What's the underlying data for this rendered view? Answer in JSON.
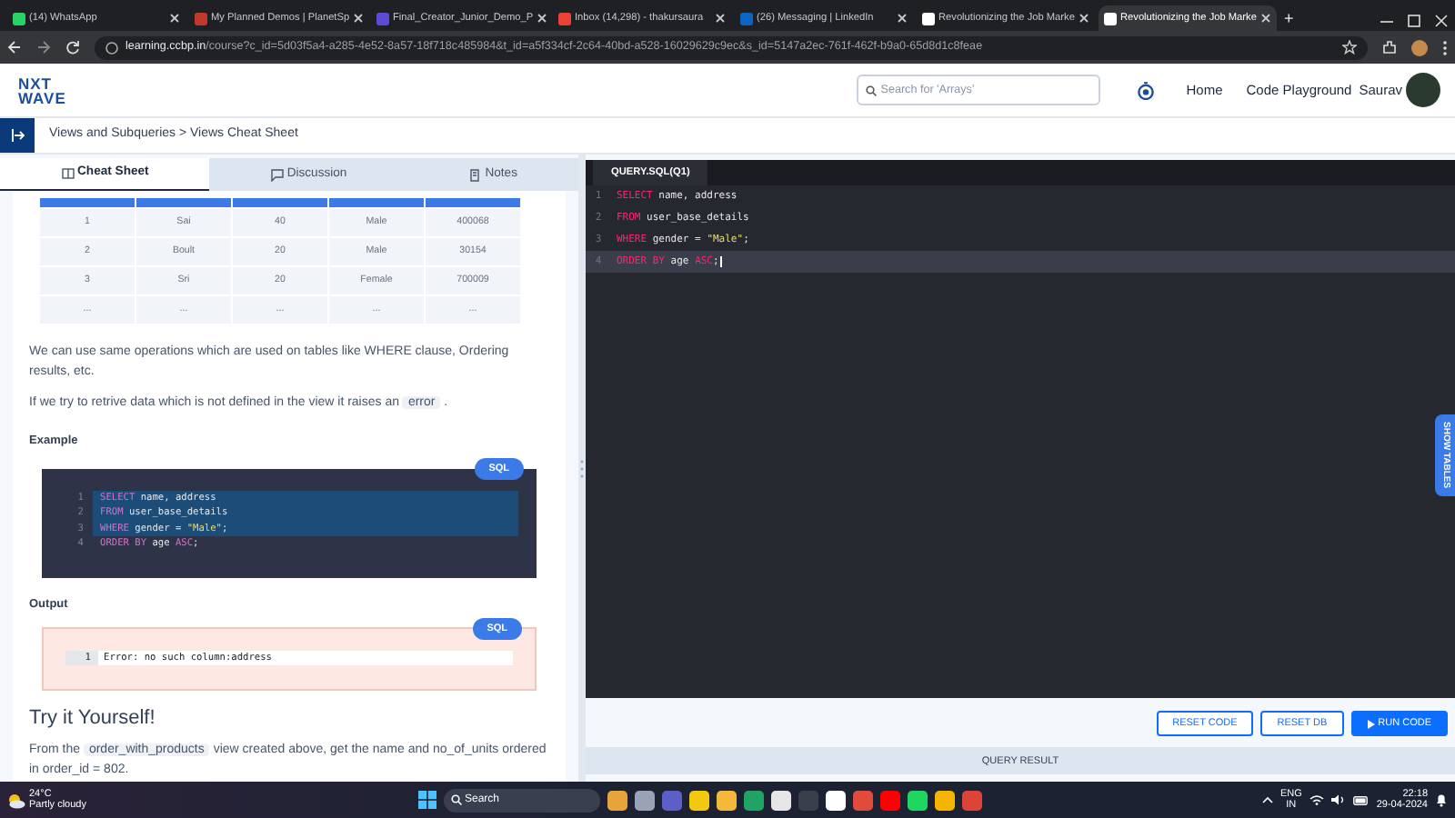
{
  "browser": {
    "tabs": [
      {
        "title": "(14) WhatsApp",
        "color": "#25d366",
        "selected": false
      },
      {
        "title": "My Planned Demos | PlanetSp",
        "color": "#c0392b",
        "selected": false
      },
      {
        "title": "Final_Creator_Junior_Demo_P",
        "color": "#5b4bd6",
        "selected": false
      },
      {
        "title": "Inbox (14,298) - thakursaura",
        "color": "#ea4335",
        "selected": false
      },
      {
        "title": "(26) Messaging | LinkedIn",
        "color": "#0a66c2",
        "selected": false
      },
      {
        "title": "Revolutionizing the Job Marke",
        "color": "#ffffff",
        "selected": false
      },
      {
        "title": "Revolutionizing the Job Marke",
        "color": "#ffffff",
        "selected": true
      }
    ],
    "new_tab": "+",
    "url_host": "learning.ccbp.in",
    "url_path": "/course?c_id=5d03f5a4-a285-4e52-8a57-18f718c485984&t_id=a5f334cf-2c64-40bd-a528-16029629c9ec&s_id=5147a2ec-761f-462f-b9a0-65d8d1c8feae"
  },
  "header": {
    "logo_top": "NXT",
    "logo_bottom": "WAVE",
    "search": {
      "placeholder": "Search for 'Arrays'"
    },
    "links": [
      "Home",
      "Code Playground"
    ],
    "user": "Saurav"
  },
  "breadcrumb": "Views and Subqueries > Views Cheat Sheet",
  "left_tabs": [
    {
      "label": "Cheat Sheet",
      "selected": true
    },
    {
      "label": "Discussion",
      "selected": false
    },
    {
      "label": "Notes",
      "selected": false
    }
  ],
  "table": {
    "rows": [
      [
        "1",
        "Sai",
        "40",
        "Male",
        "400068"
      ],
      [
        "2",
        "Boult",
        "20",
        "Male",
        "30154"
      ],
      [
        "3",
        "Sri",
        "20",
        "Female",
        "700009"
      ],
      [
        "...",
        "...",
        "...",
        "...",
        "..."
      ]
    ]
  },
  "paragraphs": [
    [
      {
        "kind": "text",
        "text": "We can use same operations which are used on tables like WHERE clause, Ordering results, etc."
      }
    ],
    [
      {
        "kind": "text",
        "text": "If we try to retrive data which is not defined in the view it raises an "
      },
      {
        "kind": "code",
        "text": "error"
      },
      {
        "kind": "text",
        "text": " ."
      }
    ]
  ],
  "example": {
    "heading": "Example",
    "badge": "SQL",
    "lines": [
      {
        "number": "1",
        "highlighted": true,
        "tokens": [
          {
            "kind": "keyword",
            "text": "SELECT"
          },
          {
            "kind": "plain",
            "text": " name, address"
          }
        ]
      },
      {
        "number": "2",
        "highlighted": true,
        "tokens": [
          {
            "kind": "keyword",
            "text": "FROM"
          },
          {
            "kind": "plain",
            "text": " user_base_details"
          }
        ]
      },
      {
        "number": "3",
        "highlighted": true,
        "tokens": [
          {
            "kind": "keyword",
            "text": "WHERE"
          },
          {
            "kind": "plain",
            "text": " gender = "
          },
          {
            "kind": "string",
            "text": "\"Male\""
          },
          {
            "kind": "plain",
            "text": ";"
          }
        ]
      },
      {
        "number": "4",
        "highlighted": false,
        "tokens": [
          {
            "kind": "keyword",
            "text": "ORDER BY"
          },
          {
            "kind": "plain",
            "text": " age "
          },
          {
            "kind": "keyword",
            "text": "ASC"
          },
          {
            "kind": "plain",
            "text": ";"
          }
        ]
      }
    ]
  },
  "output": {
    "heading": "Output",
    "badge": "SQL",
    "line_number": "1",
    "text": "Error: no such column:address"
  },
  "try_heading": "Try it Yourself!",
  "try_paragraph": [
    {
      "kind": "text",
      "text": "From the "
    },
    {
      "kind": "code",
      "text": "order_with_products"
    },
    {
      "kind": "text",
      "text": " view created above, get the name and no_of_units ordered in order_id = 802."
    }
  ],
  "editor": {
    "tab": "QUERY.SQL(Q1)",
    "lines": [
      {
        "number": "1",
        "active": false,
        "tokens": [
          {
            "kind": "keyword",
            "text": "SELECT"
          },
          {
            "kind": "plain",
            "text": " name, address"
          }
        ]
      },
      {
        "number": "2",
        "active": false,
        "tokens": [
          {
            "kind": "keyword",
            "text": "FROM"
          },
          {
            "kind": "plain",
            "text": " user_base_details"
          }
        ]
      },
      {
        "number": "3",
        "active": false,
        "tokens": [
          {
            "kind": "keyword",
            "text": "WHERE"
          },
          {
            "kind": "plain",
            "text": " gender = "
          },
          {
            "kind": "string",
            "text": "\"Male\""
          },
          {
            "kind": "plain",
            "text": ";"
          }
        ]
      },
      {
        "number": "4",
        "active": true,
        "tokens": [
          {
            "kind": "keyword",
            "text": "ORDER BY"
          },
          {
            "kind": "plain",
            "text": " age "
          },
          {
            "kind": "keyword",
            "text": "ASC"
          },
          {
            "kind": "plain",
            "text": ";"
          }
        ]
      }
    ],
    "side_tab": "SHOW TABLES",
    "buttons": [
      {
        "label": "RESET CODE",
        "kind": "outline"
      },
      {
        "label": "RESET DB",
        "kind": "outline"
      },
      {
        "label": "RUN CODE",
        "kind": "primary"
      }
    ],
    "result_bar": "QUERY RESULT"
  },
  "taskbar": {
    "temperature": "24°C",
    "weather": "Partly cloudy",
    "search": "Search",
    "apps": [
      {
        "color": "#e8a33c"
      },
      {
        "color": "#9aa3b5"
      },
      {
        "color": "#5b5fc7"
      },
      {
        "color": "#f2c811"
      },
      {
        "color": "#f5b83d"
      },
      {
        "color": "#1fa463"
      },
      {
        "color": "#e6e6e6"
      },
      {
        "color": "#3a3f4b"
      },
      {
        "color": "#ffffff"
      },
      {
        "color": "#e04b3c"
      },
      {
        "color": "#ff0000"
      },
      {
        "color": "#1ed760"
      },
      {
        "color": "#f4b400"
      },
      {
        "color": "#db4437"
      }
    ],
    "language": "ENG",
    "region": "IN",
    "time": "22:18",
    "date": "29-04-2024"
  }
}
